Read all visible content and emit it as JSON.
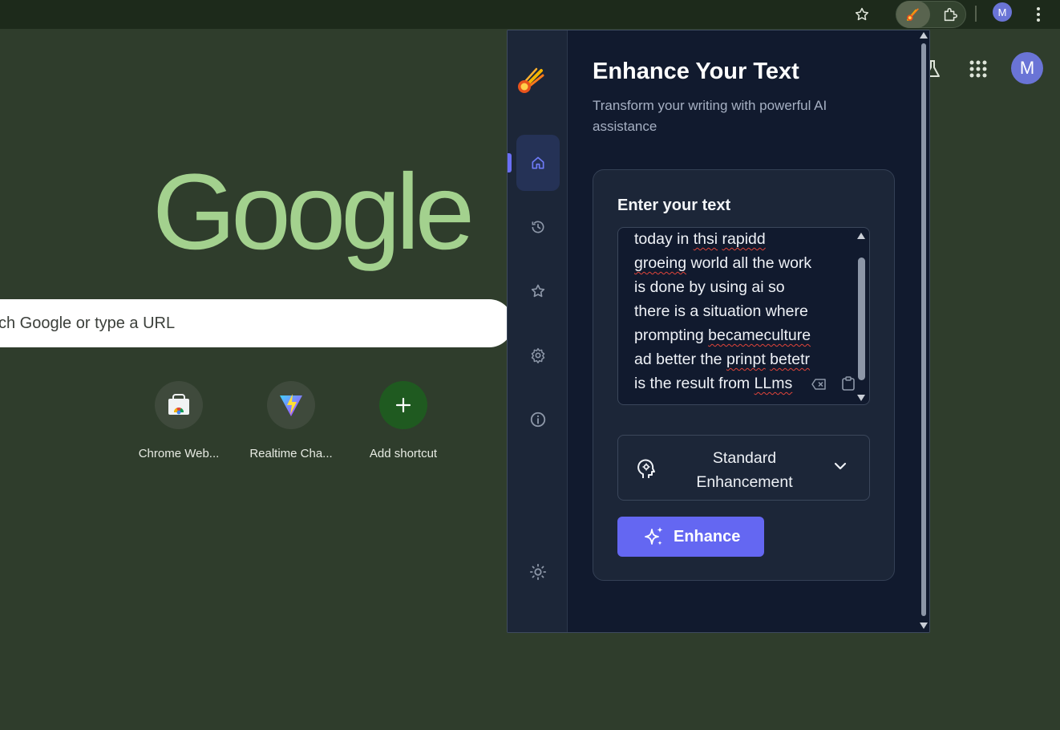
{
  "browser": {
    "colors": {
      "topbar": "#1d2a1b",
      "page_bg": "#2f3d2c"
    },
    "toolbar_icons": [
      "star-icon",
      "meteor-extension-icon",
      "puzzle-icon",
      "profile-avatar",
      "more-vert-icon"
    ],
    "profile_initial": "M"
  },
  "ntp": {
    "logo": "Google",
    "search_placeholder": "ch Google or type a URL",
    "shortcuts": [
      {
        "label": "Chrome Web...",
        "icon": "chrome-web-store-icon"
      },
      {
        "label": "Realtime Cha...",
        "icon": "vite-icon"
      },
      {
        "label": "Add shortcut",
        "icon": "plus-icon"
      }
    ],
    "profile_initial": "M",
    "right_icons": [
      "labs-flask-icon",
      "apps-grid-icon"
    ]
  },
  "popup": {
    "title": "Enhance Your Text",
    "subtitle": "Transform your writing with powerful AI assistance",
    "sidebar_items": [
      "home-icon",
      "history-icon",
      "star-icon",
      "settings-icon",
      "info-icon"
    ],
    "theme_toggle": "sun-icon",
    "input_label": "Enter your text",
    "input_lines": [
      "today in thsi rapidd",
      "groeing world all the work",
      "is done by using ai so",
      "there is a situation where",
      "prompting becameculture",
      "ad better the prinpt betetr",
      "is the result from LLms"
    ],
    "mode_select": "Standard Enhancement",
    "enhance_button": "Enhance",
    "colors": {
      "accent": "#6467f2",
      "panel": "#111a2e",
      "card": "#1c2638"
    }
  }
}
